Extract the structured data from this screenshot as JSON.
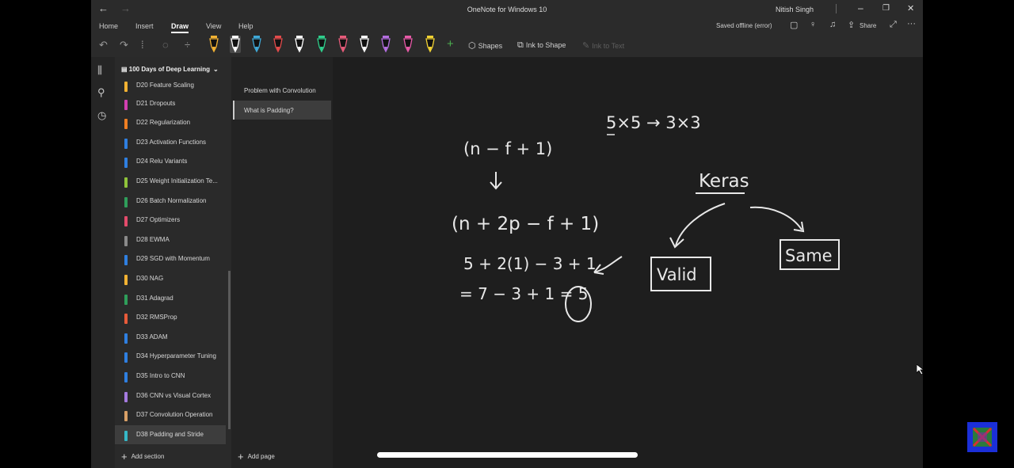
{
  "window": {
    "title": "OneNote for Windows 10",
    "user": "Nitish Singh",
    "back_glyph": "←",
    "forward_glyph": "→",
    "minimize_glyph": "–",
    "maximize_glyph": "❐",
    "close_glyph": "✕"
  },
  "ribbon": {
    "tabs": [
      "Home",
      "Insert",
      "Draw",
      "View",
      "Help"
    ],
    "active_tab": "Draw",
    "status": "Saved offline (error)",
    "share_label": "Share",
    "more_glyph": "···"
  },
  "toolbar": {
    "shapes_label": "Shapes",
    "ink_to_shape_label": "Ink to Shape",
    "ink_to_text_label": "Ink to Text",
    "pen_colors": [
      "#f2b233",
      "#ffffff",
      "#3fa9d8",
      "#e34b4b",
      "#ffffff",
      "#2fcf8c",
      "#e85b7a",
      "#ffffff",
      "#b46ee0",
      "#e85aa8",
      "#f2d233"
    ]
  },
  "notebook": {
    "name": "100 Days of Deep Learning",
    "add_section_label": "Add section",
    "sections": [
      {
        "label": "D20 Feature Scaling",
        "color": "#f2b233"
      },
      {
        "label": "D21 Dropouts",
        "color": "#d23fb0"
      },
      {
        "label": "D22 Regularization",
        "color": "#f07f22"
      },
      {
        "label": "D23 Activation Functions",
        "color": "#2f7fe0"
      },
      {
        "label": "D24 Relu Variants",
        "color": "#2f7fe0"
      },
      {
        "label": "D25 Weight Initialization Te...",
        "color": "#8fc43a"
      },
      {
        "label": "D26 Batch Normalization",
        "color": "#2f9e5a"
      },
      {
        "label": "D27 Optimizers",
        "color": "#e34b6b"
      },
      {
        "label": "D28 EWMA",
        "color": "#8a8a8a"
      },
      {
        "label": "D29 SGD with Momentum",
        "color": "#2f7fe0"
      },
      {
        "label": "D30 NAG",
        "color": "#f2b233"
      },
      {
        "label": "D31 Adagrad",
        "color": "#2f9e5a"
      },
      {
        "label": "D32 RMSProp",
        "color": "#e85b3a"
      },
      {
        "label": "D33 ADAM",
        "color": "#2f7fe0"
      },
      {
        "label": "D34 Hyperparameter Tuning",
        "color": "#2f7fe0"
      },
      {
        "label": "D35 Intro to CNN",
        "color": "#2f7fe0"
      },
      {
        "label": "D36 CNN vs Visual Cortex",
        "color": "#a57be0"
      },
      {
        "label": "D37 Convolution Operation",
        "color": "#d9a067"
      },
      {
        "label": "D38 Padding and Stride",
        "color": "#35b8c8"
      }
    ],
    "selected_section": 18
  },
  "pages": {
    "items": [
      "Problem with Convolution",
      "What is Padding?"
    ],
    "selected": 1,
    "add_page_label": "Add page"
  },
  "ink_notes": {
    "dims": "5×5 → 3×3",
    "formula_1": "(n − f + 1)",
    "formula_2": "(n + 2p − f + 1)",
    "calc_1": "5 + 2(1) − 3 + 1",
    "calc_2": "= 7 − 3 + 1 = 5",
    "keras": "Keras",
    "valid": "Valid",
    "same": "Same"
  }
}
